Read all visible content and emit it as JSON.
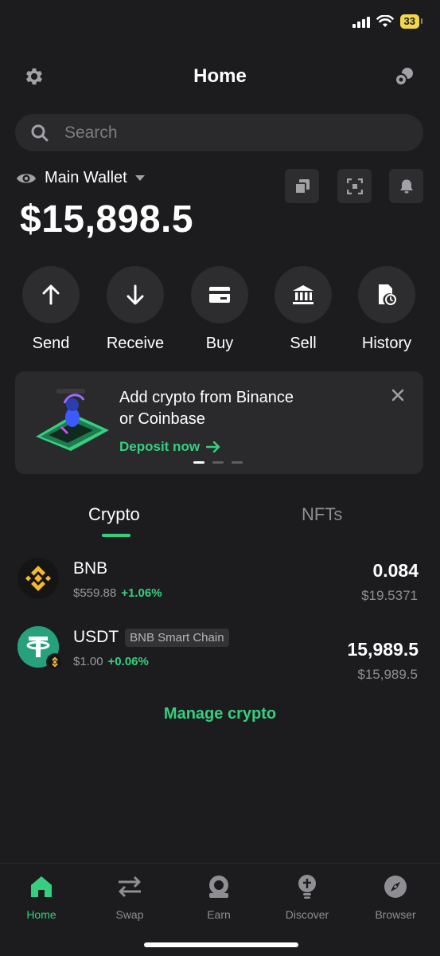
{
  "status_bar": {
    "battery": "33"
  },
  "header": {
    "title": "Home"
  },
  "search": {
    "placeholder": "Search"
  },
  "wallet": {
    "name": "Main Wallet",
    "balance": "$15,898.5"
  },
  "actions": [
    {
      "label": "Send",
      "icon": "arrow-up-icon"
    },
    {
      "label": "Receive",
      "icon": "arrow-down-icon"
    },
    {
      "label": "Buy",
      "icon": "card-icon"
    },
    {
      "label": "Sell",
      "icon": "bank-icon"
    },
    {
      "label": "History",
      "icon": "history-icon"
    }
  ],
  "banner": {
    "line1": "Add crypto from Binance",
    "line2": "or Coinbase",
    "cta": "Deposit now",
    "page_count": 3,
    "active_page": 1
  },
  "tabs": [
    {
      "label": "Crypto",
      "active": true
    },
    {
      "label": "NFTs",
      "active": false
    }
  ],
  "assets": [
    {
      "symbol": "BNB",
      "chain": "",
      "price": "$559.88",
      "change": "+1.06%",
      "amount": "0.084",
      "fiat": "$19.5371",
      "color": "#f3ba2f"
    },
    {
      "symbol": "USDT",
      "chain": "BNB Smart Chain",
      "price": "$1.00",
      "change": "+0.06%",
      "amount": "15,989.5",
      "fiat": "$15,989.5",
      "color": "#26a17b"
    }
  ],
  "manage_label": "Manage crypto",
  "bottom_nav": [
    {
      "label": "Home",
      "active": true,
      "icon": "home-icon"
    },
    {
      "label": "Swap",
      "active": false,
      "icon": "swap-icon"
    },
    {
      "label": "Earn",
      "active": false,
      "icon": "earn-icon"
    },
    {
      "label": "Discover",
      "active": false,
      "icon": "discover-icon"
    },
    {
      "label": "Browser",
      "active": false,
      "icon": "browser-icon"
    }
  ],
  "colors": {
    "accent": "#35d07f",
    "background": "#1c1c1e",
    "surface": "#2a2a2c"
  }
}
